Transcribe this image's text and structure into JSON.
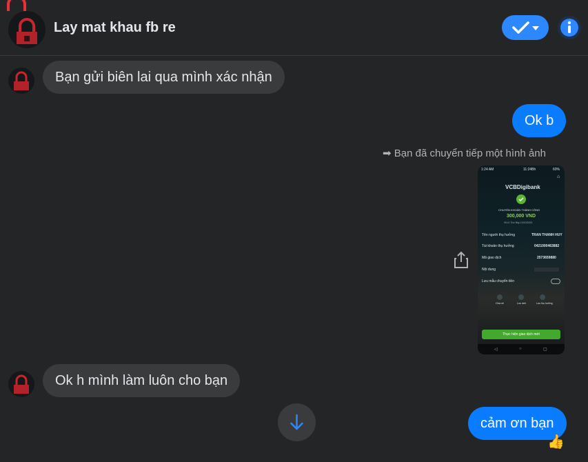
{
  "header": {
    "title": "Lay mat khau fb re"
  },
  "messages": [
    {
      "direction": "in",
      "text": "Bạn gửi biên lai qua mình xác nhận"
    },
    {
      "direction": "out",
      "text": "Ok b"
    },
    {
      "direction": "out",
      "forward_note": "Bạn đã chuyển tiếp một hình ảnh"
    },
    {
      "direction": "in",
      "text": "Ok h mình làm luôn cho bạn"
    },
    {
      "direction": "out",
      "text": "cảm ơn bạn",
      "reaction": "👍"
    }
  ],
  "receipt": {
    "status_time_left": "1:24 AM",
    "status_time_right": "11:24Bh",
    "battery": "60%",
    "brand": "VCB",
    "brand_suffix": "Digibank",
    "success_label": "CHUYỂN KHOẢN THÀNH CÔNG",
    "amount": "300,000 VND",
    "date": "09:11 Thứ Bảy 10/10/2023",
    "rows": [
      {
        "label": "Tên người thụ hưởng",
        "value": "TRAN THANH HUY"
      },
      {
        "label": "Tài khoản thụ hưởng",
        "value": "0421000463882"
      },
      {
        "label": "Mã giao dịch",
        "value": "2573659880"
      },
      {
        "label": "Nội dung",
        "value": ""
      }
    ],
    "save_template_label": "Lưu mẫu chuyển tiền",
    "action_labels": [
      "Chia sẻ",
      "Lưu ảnh",
      "Lưu thụ hưởng"
    ],
    "new_transaction_button": "Thực hiện giao dịch mới"
  },
  "colors": {
    "background": "#242526",
    "incoming_bubble": "#3a3b3c",
    "outgoing_bubble": "#0a7cff",
    "accent": "#2d88ff"
  }
}
